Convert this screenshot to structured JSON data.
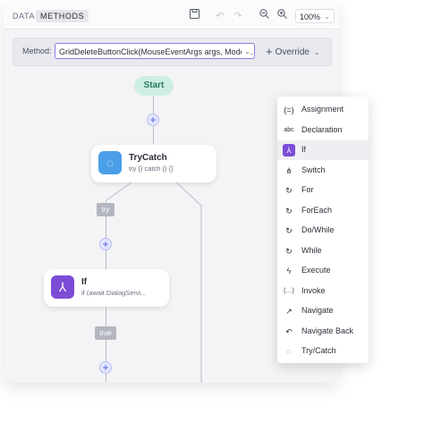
{
  "tabs": {
    "data": "DATA",
    "methods": "METHODS"
  },
  "toolbar": {
    "zoom": "100%"
  },
  "method_bar": {
    "label": "Method:",
    "value": "GridDeleteButtonClick(MouseEventArgs args, Models.",
    "override_label": "Override"
  },
  "flow": {
    "start_label": "Start",
    "trycatch": {
      "title": "TryCatch",
      "subtitle": "try {} catch () {}"
    },
    "try_label": "try",
    "if_node": {
      "title": "If",
      "subtitle": "if (await DialogServi..."
    },
    "true_label": "true"
  },
  "menu": {
    "items": [
      {
        "label": "Assignment",
        "icon": "(=)"
      },
      {
        "label": "Declaration",
        "icon": "abc"
      },
      {
        "label": "If",
        "icon": "⅄"
      },
      {
        "label": "Switch",
        "icon": "⋔"
      },
      {
        "label": "For",
        "icon": "↻"
      },
      {
        "label": "ForEach",
        "icon": "↻"
      },
      {
        "label": "Do/While",
        "icon": "↻"
      },
      {
        "label": "While",
        "icon": "↻"
      },
      {
        "label": "Execute",
        "icon": "ϟ"
      },
      {
        "label": "Invoke",
        "icon": "(…)"
      },
      {
        "label": "Navigate",
        "icon": "↗"
      },
      {
        "label": "Navigate Back",
        "icon": "↶"
      },
      {
        "label": "Try/Catch",
        "icon": "◌"
      }
    ],
    "active_index": 2
  },
  "colors": {
    "accent": "#7c4cd6",
    "trycatch_icon": "#4a9fe8",
    "start_bg": "#cdeee4"
  }
}
